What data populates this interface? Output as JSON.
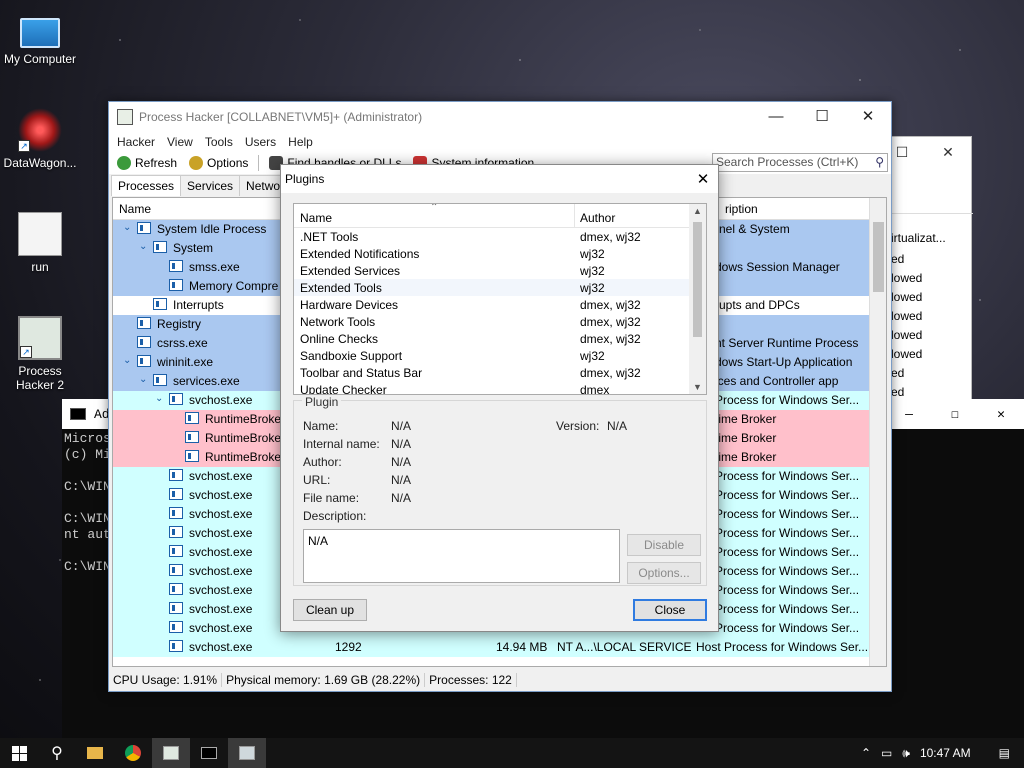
{
  "desktop": {
    "icons": [
      {
        "label": "My Computer",
        "icon": "computer-icon"
      },
      {
        "label": "DataWagon...",
        "icon": "datawagon-icon"
      },
      {
        "label": "run",
        "icon": "run-icon"
      },
      {
        "label": "Process\nHacker 2",
        "icon": "process-hacker-icon"
      }
    ]
  },
  "cmd": {
    "title": "Ad",
    "lines": "Micros\n(c) Mi\n\nC:\\WIN\n\nC:\\WIN\nnt aut\n\nC:\\WIN"
  },
  "main_window": {
    "title": "Process Hacker [COLLABNET\\VM5]+ (Administrator)",
    "menu": [
      "Hacker",
      "View",
      "Tools",
      "Users",
      "Help"
    ],
    "toolbar": {
      "refresh": "Refresh",
      "options": "Options",
      "find_handles": "Find handles or DLLs",
      "system_info": "System information"
    },
    "search_placeholder": "Search Processes (Ctrl+K)",
    "tabs": [
      "Processes",
      "Services",
      "Network"
    ],
    "columns": {
      "name": "Name",
      "description": "ription"
    },
    "processes": [
      {
        "name": "System Idle Process",
        "desc": "rnel & System",
        "color": "blue",
        "indent": 0,
        "toggle": "v"
      },
      {
        "name": "System",
        "desc": "",
        "color": "blue",
        "indent": 1,
        "toggle": "v"
      },
      {
        "name": "smss.exe",
        "desc": "dows Session Manager",
        "color": "blue",
        "indent": 2,
        "toggle": ""
      },
      {
        "name": "Memory Compre",
        "desc": "",
        "color": "blue",
        "indent": 2,
        "toggle": ""
      },
      {
        "name": "Interrupts",
        "desc": "rupts and DPCs",
        "color": "white",
        "indent": 1,
        "toggle": ""
      },
      {
        "name": "Registry",
        "desc": "",
        "color": "blue",
        "indent": 0,
        "toggle": ""
      },
      {
        "name": "csrss.exe",
        "desc": "nt Server Runtime Process",
        "color": "blue",
        "indent": 0,
        "toggle": ""
      },
      {
        "name": "wininit.exe",
        "desc": "dows Start-Up Application",
        "color": "blue",
        "indent": 0,
        "toggle": "v"
      },
      {
        "name": "services.exe",
        "desc": "ices and Controller app",
        "color": "blue",
        "indent": 1,
        "toggle": "v"
      },
      {
        "name": "svchost.exe",
        "desc": "Process for Windows Ser...",
        "color": "cyan",
        "indent": 2,
        "toggle": "v"
      },
      {
        "name": "RuntimeBroker",
        "desc": "time Broker",
        "color": "pink",
        "indent": 3,
        "toggle": ""
      },
      {
        "name": "RuntimeBroker",
        "desc": "time Broker",
        "color": "pink",
        "indent": 3,
        "toggle": ""
      },
      {
        "name": "RuntimeBroker",
        "desc": "time Broker",
        "color": "pink",
        "indent": 3,
        "toggle": ""
      },
      {
        "name": "svchost.exe",
        "desc": "Process for Windows Ser...",
        "color": "cyan",
        "indent": 2,
        "toggle": ""
      },
      {
        "name": "svchost.exe",
        "desc": "Process for Windows Ser...",
        "color": "cyan",
        "indent": 2,
        "toggle": ""
      },
      {
        "name": "svchost.exe",
        "desc": "Process for Windows Ser...",
        "color": "cyan",
        "indent": 2,
        "toggle": ""
      },
      {
        "name": "svchost.exe",
        "desc": "Process for Windows Ser...",
        "color": "cyan",
        "indent": 2,
        "toggle": ""
      },
      {
        "name": "svchost.exe",
        "desc": "Process for Windows Ser...",
        "color": "cyan",
        "indent": 2,
        "toggle": ""
      },
      {
        "name": "svchost.exe",
        "desc": "Process for Windows Ser...",
        "color": "cyan",
        "indent": 2,
        "toggle": ""
      },
      {
        "name": "svchost.exe",
        "desc": "Process for Windows Ser...",
        "color": "cyan",
        "indent": 2,
        "toggle": ""
      },
      {
        "name": "svchost.exe",
        "desc": "Process for Windows Ser...",
        "color": "cyan",
        "indent": 2,
        "toggle": ""
      },
      {
        "name": "svchost.exe",
        "desc": "Process for Windows Ser...",
        "color": "cyan",
        "indent": 2,
        "toggle": ""
      },
      {
        "name": "svchost.exe",
        "desc": "Host Process for Windows Ser...",
        "color": "cyan",
        "indent": 2,
        "toggle": "",
        "pid": "1292",
        "mem": "14.94 MB",
        "user": "NT A...\\LOCAL SERVICE"
      }
    ],
    "status": {
      "cpu": "CPU Usage: 1.91%",
      "memory": "Physical memory: 1.69 GB (28.22%)",
      "processes": "Processes: 122"
    }
  },
  "bg_window_right": {
    "col_header": "irtualizat...",
    "rows": [
      "ed",
      "lowed",
      "lowed",
      "lowed",
      "lowed",
      "lowed",
      "ed",
      "ed"
    ]
  },
  "plugins_dialog": {
    "title": "Plugins",
    "columns": {
      "name": "Name",
      "author": "Author"
    },
    "plugins": [
      {
        "name": ".NET Tools",
        "author": "dmex, wj32"
      },
      {
        "name": "Extended Notifications",
        "author": "wj32"
      },
      {
        "name": "Extended Services",
        "author": "wj32"
      },
      {
        "name": "Extended Tools",
        "author": "wj32"
      },
      {
        "name": "Hardware Devices",
        "author": "dmex, wj32"
      },
      {
        "name": "Network Tools",
        "author": "dmex, wj32"
      },
      {
        "name": "Online Checks",
        "author": "dmex, wj32"
      },
      {
        "name": "Sandboxie Support",
        "author": "wj32"
      },
      {
        "name": "Toolbar and Status Bar",
        "author": "dmex, wj32"
      },
      {
        "name": "Update Checker",
        "author": "dmex"
      }
    ],
    "group_label": "Plugin",
    "fields": {
      "name_label": "Name:",
      "name_value": "N/A",
      "version_label": "Version:",
      "version_value": "N/A",
      "internal_label": "Internal name:",
      "internal_value": "N/A",
      "author_label": "Author:",
      "author_value": "N/A",
      "url_label": "URL:",
      "url_value": "N/A",
      "file_label": "File name:",
      "file_value": "N/A",
      "desc_label": "Description:",
      "desc_value": "N/A"
    },
    "buttons": {
      "disable": "Disable",
      "options": "Options...",
      "cleanup": "Clean up",
      "close": "Close"
    }
  },
  "taskbar": {
    "time": "10:47 AM"
  },
  "colors": {
    "blue": "#aac8f0",
    "cyan": "#d0ffff",
    "pink": "#ffc0cb",
    "accent": "#2f7be0"
  }
}
